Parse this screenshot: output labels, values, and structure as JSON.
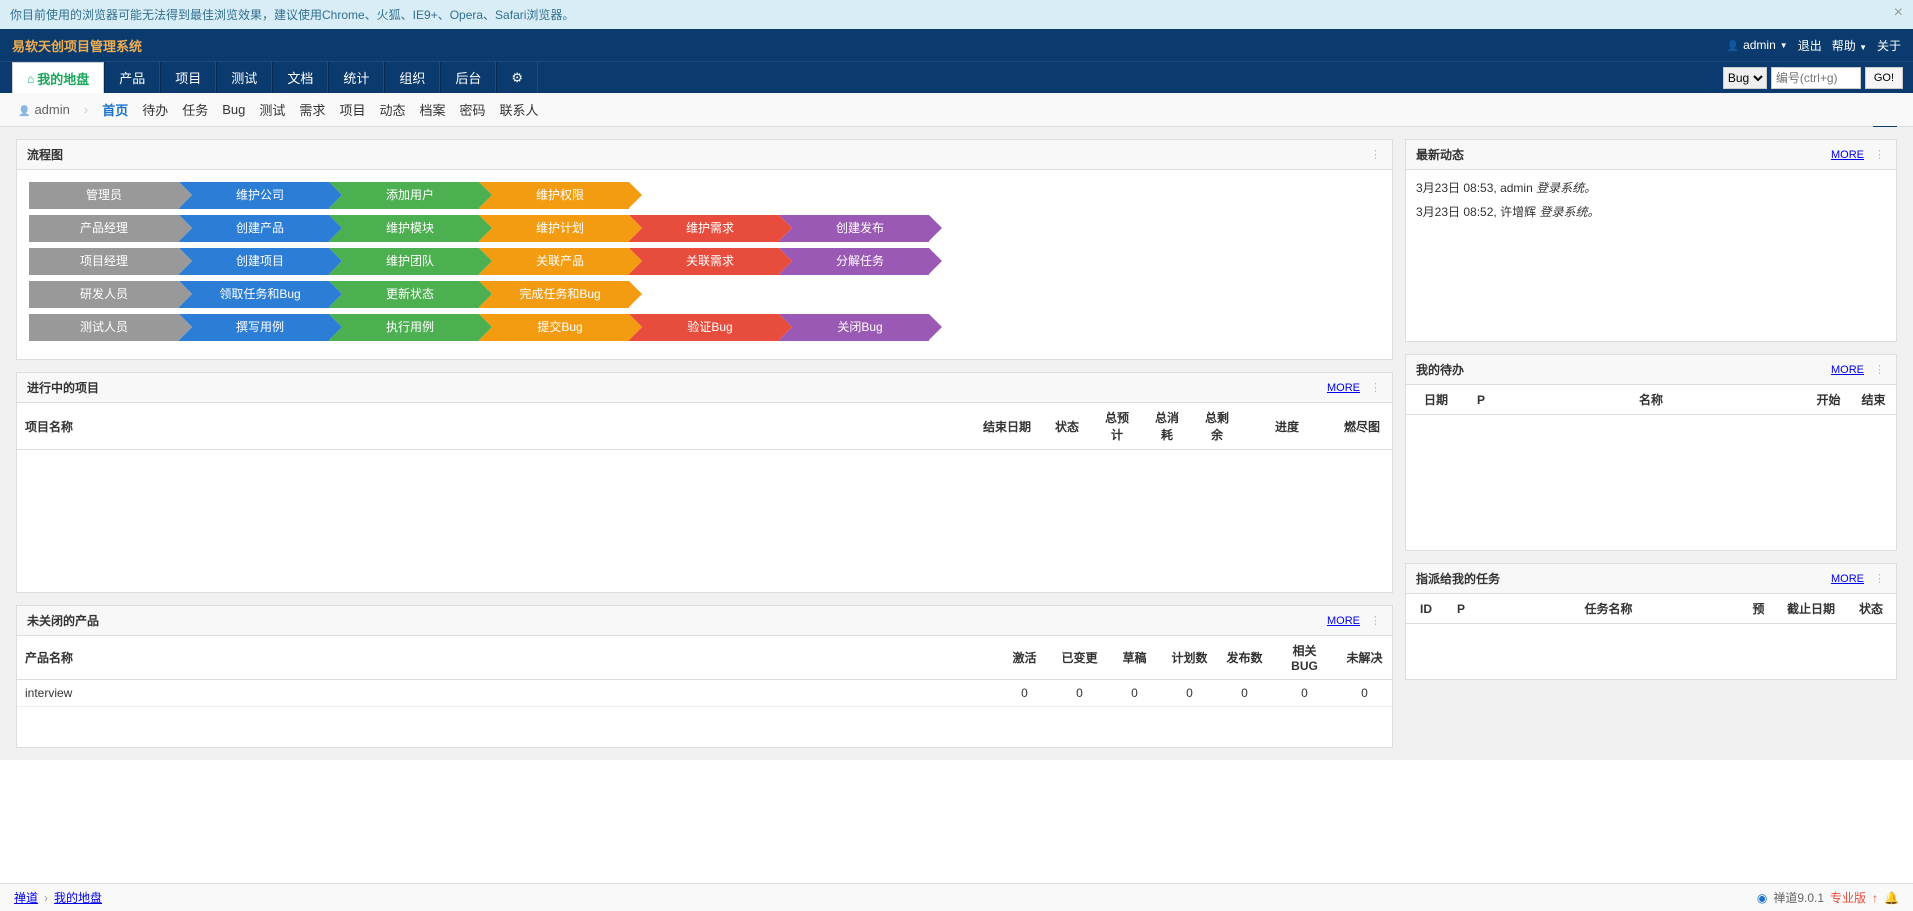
{
  "warning": {
    "text": "你目前使用的浏览器可能无法得到最佳浏览效果，建议使用Chrome、火狐、IE9+、Opera、Safari浏览器。"
  },
  "header": {
    "brand": "易软天创项目管理系统",
    "user": "admin",
    "logout": "退出",
    "help": "帮助",
    "about": "关于"
  },
  "mainnav": {
    "items": [
      "我的地盘",
      "产品",
      "项目",
      "测试",
      "文档",
      "统计",
      "组织",
      "后台"
    ],
    "search_type": "Bug",
    "search_placeholder": "编号(ctrl+g)",
    "go": "GO!"
  },
  "subnav": {
    "user": "admin",
    "items": [
      "首页",
      "待办",
      "任务",
      "Bug",
      "测试",
      "需求",
      "项目",
      "动态",
      "档案",
      "密码",
      "联系人"
    ]
  },
  "flowchart": {
    "title": "流程图",
    "rows": [
      {
        "role": "管理员",
        "steps": [
          {
            "c": "blue",
            "t": "维护公司"
          },
          {
            "c": "green",
            "t": "添加用户"
          },
          {
            "c": "orange",
            "t": "维护权限"
          }
        ]
      },
      {
        "role": "产品经理",
        "steps": [
          {
            "c": "blue",
            "t": "创建产品"
          },
          {
            "c": "green",
            "t": "维护模块"
          },
          {
            "c": "orange",
            "t": "维护计划"
          },
          {
            "c": "red",
            "t": "维护需求"
          },
          {
            "c": "purple",
            "t": "创建发布"
          }
        ]
      },
      {
        "role": "项目经理",
        "steps": [
          {
            "c": "blue",
            "t": "创建项目"
          },
          {
            "c": "green",
            "t": "维护团队"
          },
          {
            "c": "orange",
            "t": "关联产品"
          },
          {
            "c": "red",
            "t": "关联需求"
          },
          {
            "c": "purple",
            "t": "分解任务"
          }
        ]
      },
      {
        "role": "研发人员",
        "steps": [
          {
            "c": "blue",
            "t": "领取任务和Bug"
          },
          {
            "c": "green",
            "t": "更新状态"
          },
          {
            "c": "orange",
            "t": "完成任务和Bug"
          }
        ]
      },
      {
        "role": "测试人员",
        "steps": [
          {
            "c": "blue",
            "t": "撰写用例"
          },
          {
            "c": "green",
            "t": "执行用例"
          },
          {
            "c": "orange",
            "t": "提交Bug"
          },
          {
            "c": "red",
            "t": "验证Bug"
          },
          {
            "c": "purple",
            "t": "关闭Bug"
          }
        ]
      }
    ]
  },
  "more_label": "MORE",
  "dynamic": {
    "title": "最新动态",
    "rows": [
      {
        "time": "3月23日 08:53,",
        "who": "admin",
        "action": "登录系统。"
      },
      {
        "time": "3月23日 08:52,",
        "who": "许增辉",
        "action": "登录系统。"
      }
    ]
  },
  "projects": {
    "title": "进行中的项目",
    "headers": [
      "项目名称",
      "结束日期",
      "状态",
      "总预计",
      "总消耗",
      "总剩余",
      "进度",
      "燃尽图"
    ]
  },
  "todo": {
    "title": "我的待办",
    "headers": [
      "日期",
      "P",
      "名称",
      "开始",
      "结束"
    ]
  },
  "products": {
    "title": "未关闭的产品",
    "headers": [
      "产品名称",
      "激活",
      "已变更",
      "草稿",
      "计划数",
      "发布数",
      "相关BUG",
      "未解决"
    ],
    "rows": [
      {
        "name": "interview",
        "v": [
          "0",
          "0",
          "0",
          "0",
          "0",
          "0",
          "0"
        ]
      }
    ]
  },
  "tasks": {
    "title": "指派给我的任务",
    "headers": [
      "ID",
      "P",
      "任务名称",
      "预",
      "截止日期",
      "状态"
    ]
  },
  "footer": {
    "crumb1": "禅道",
    "crumb2": "我的地盘",
    "app": "禅道9.0.1",
    "edition": "专业版"
  }
}
